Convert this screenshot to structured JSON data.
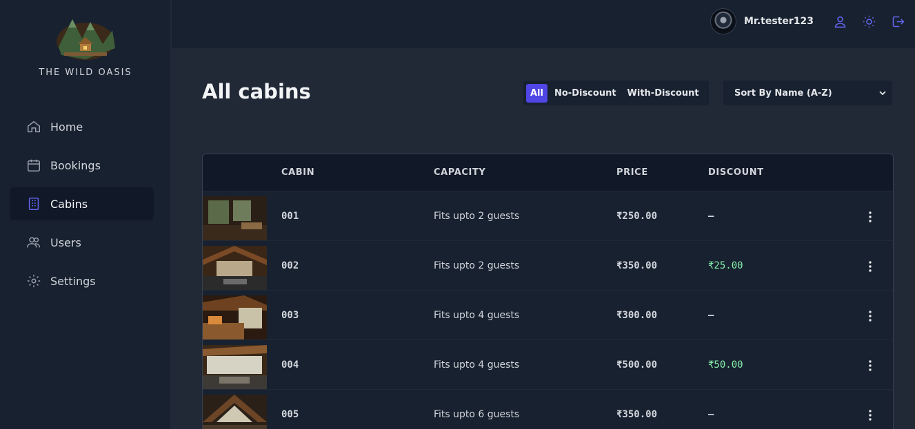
{
  "brand": {
    "name": "THE WILD OASIS",
    "logo_icon": "mountain-cabin-logo"
  },
  "sidebar": {
    "items": [
      {
        "label": "Home",
        "icon": "home-icon",
        "active": false
      },
      {
        "label": "Bookings",
        "icon": "calendar-icon",
        "active": false
      },
      {
        "label": "Cabins",
        "icon": "building-icon",
        "active": true
      },
      {
        "label": "Users",
        "icon": "users-icon",
        "active": false
      },
      {
        "label": "Settings",
        "icon": "gear-icon",
        "active": false
      }
    ]
  },
  "header": {
    "username": "Mr.tester123",
    "icons": [
      "user-icon",
      "sun-icon",
      "logout-icon"
    ]
  },
  "page": {
    "title": "All cabins",
    "filters": [
      {
        "label": "All",
        "active": true
      },
      {
        "label": "No-Discount",
        "active": false
      },
      {
        "label": "With-Discount",
        "active": false
      }
    ],
    "sort_selected": "Sort By Name (A-Z)"
  },
  "table": {
    "columns": [
      "",
      "CABIN",
      "CAPACITY",
      "PRICE",
      "DISCOUNT"
    ],
    "rows": [
      {
        "name": "001",
        "capacity": "Fits upto 2 guests",
        "price": "₹250.00",
        "discount": "—"
      },
      {
        "name": "002",
        "capacity": "Fits upto 2 guests",
        "price": "₹350.00",
        "discount": "₹25.00"
      },
      {
        "name": "003",
        "capacity": "Fits upto 4 guests",
        "price": "₹300.00",
        "discount": "—"
      },
      {
        "name": "004",
        "capacity": "Fits upto 4 guests",
        "price": "₹500.00",
        "discount": "₹50.00"
      },
      {
        "name": "005",
        "capacity": "Fits upto 6 guests",
        "price": "₹350.00",
        "discount": "—"
      }
    ]
  },
  "colors": {
    "accent": "#4f46e5",
    "sidebar_bg": "#18212f",
    "page_bg": "#212836",
    "discount_green": "#86efac"
  }
}
